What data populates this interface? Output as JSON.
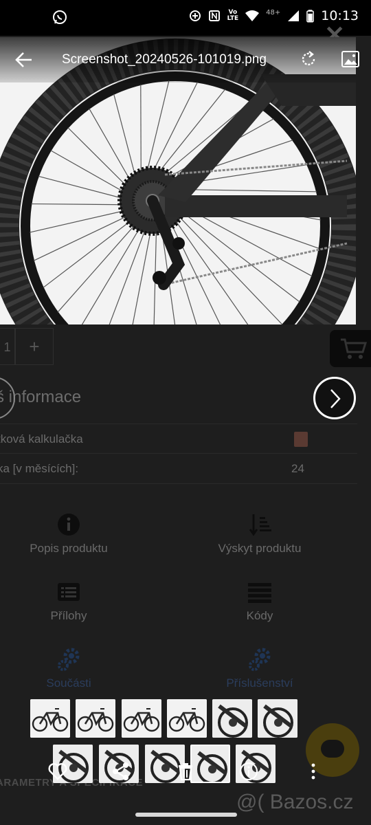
{
  "status_bar": {
    "time": "10:13",
    "network_badge": "48+",
    "volte": "Vo",
    "lte": "LTE"
  },
  "viewer": {
    "file_name": "Screenshot_20240526-101019.png",
    "close_glyph": "✕"
  },
  "page": {
    "quantity": "1",
    "plus": "+",
    "section_title": "š informace",
    "calculator_label": "tková kalkulačka",
    "installment_label": "ka [v měsících]:",
    "installment_value": "24",
    "tiles": [
      {
        "label": "Popis produktu",
        "icon": "info-icon"
      },
      {
        "label": "Výskyt produktu",
        "icon": "sort-icon"
      },
      {
        "label": "Přílohy",
        "icon": "attachment-icon"
      },
      {
        "label": "Kódy",
        "icon": "list-icon"
      },
      {
        "label": "Součásti",
        "icon": "gears-icon"
      },
      {
        "label": "Příslušenství",
        "icon": "gears-icon"
      }
    ],
    "params_heading": "ARAMETRY A SPECIFIKACE",
    "watermark": "@( Bazos.cz"
  },
  "colors": {
    "accent_blue": "#2b3d5c",
    "chat_fab": "#4a3e0e",
    "background": "#1e1e1e"
  }
}
